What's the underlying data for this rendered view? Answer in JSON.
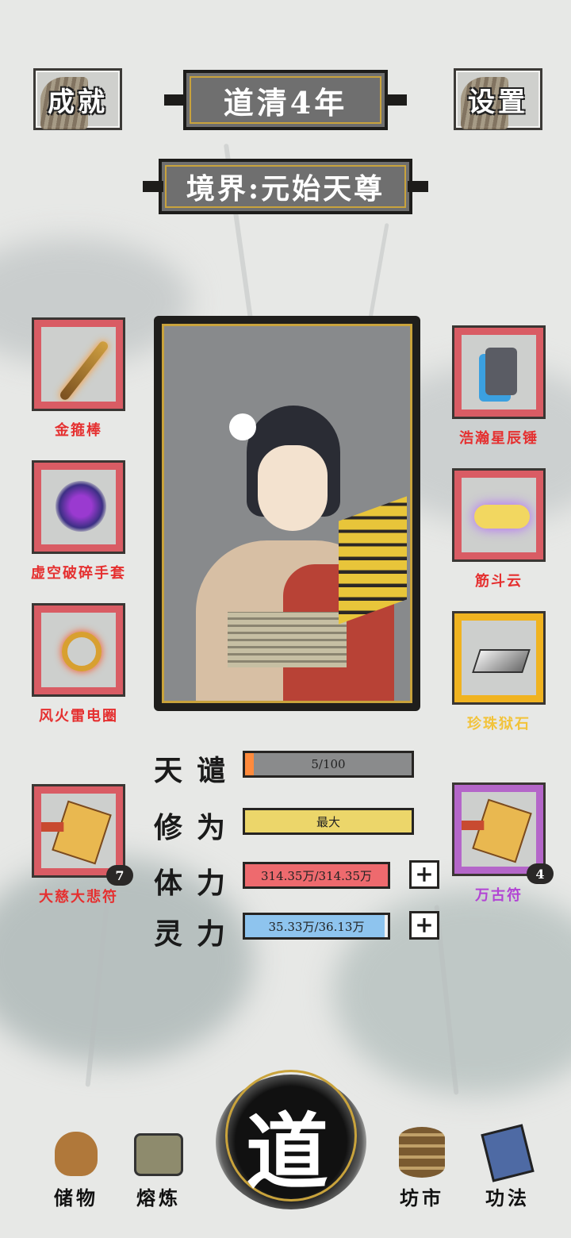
{
  "header": {
    "achievements_label": "成就",
    "settings_label": "设置",
    "year_label": "道清4年",
    "realm_label": "境界:元始天尊"
  },
  "equipment": {
    "left": [
      {
        "name": "金箍棒",
        "icon": "staff-icon",
        "rarity": "red"
      },
      {
        "name": "虚空破碎手套",
        "icon": "glove-icon",
        "rarity": "red"
      },
      {
        "name": "风火雷电圈",
        "icon": "ring-icon",
        "rarity": "red"
      }
    ],
    "right": [
      {
        "name": "浩瀚星辰锤",
        "icon": "hammer-icon",
        "rarity": "red"
      },
      {
        "name": "筋斗云",
        "icon": "cloud-icon",
        "rarity": "red"
      },
      {
        "name": "珍珠狱石",
        "icon": "stone-icon",
        "rarity": "gold"
      }
    ]
  },
  "talismans": [
    {
      "name": "大慈大悲符",
      "count": "7",
      "icon": "talisman-icon",
      "rarity": "red"
    },
    {
      "name": "万古符",
      "count": "4",
      "icon": "talisman-icon",
      "rarity": "purple"
    }
  ],
  "stats": [
    {
      "label": "天谴",
      "value": "5/100",
      "fill": 0.05,
      "color": "#ff8a3c",
      "track": "#8a8b8c"
    },
    {
      "label": "修为",
      "value": "最大",
      "fill": 1.0,
      "color": "#ecd66a",
      "track": "#ecd66a"
    },
    {
      "label": "体力",
      "value": "314.35万/314.35万",
      "fill": 1.0,
      "color": "#ee6a6e",
      "track": "#ee6a6e"
    },
    {
      "label": "灵力",
      "value": "35.33万/36.13万",
      "fill": 0.978,
      "color": "#8ec4ee",
      "track": "#f0f0f0"
    }
  ],
  "add_label": "+",
  "nav": {
    "storage": "储物",
    "smelt": "熔炼",
    "dao": "道",
    "market": "坊市",
    "skills": "功法"
  },
  "colors": {
    "item_red": "#e53030",
    "item_gold": "#f2c33a",
    "item_purple": "#b244d4",
    "frame_gold": "#c9a33c"
  }
}
